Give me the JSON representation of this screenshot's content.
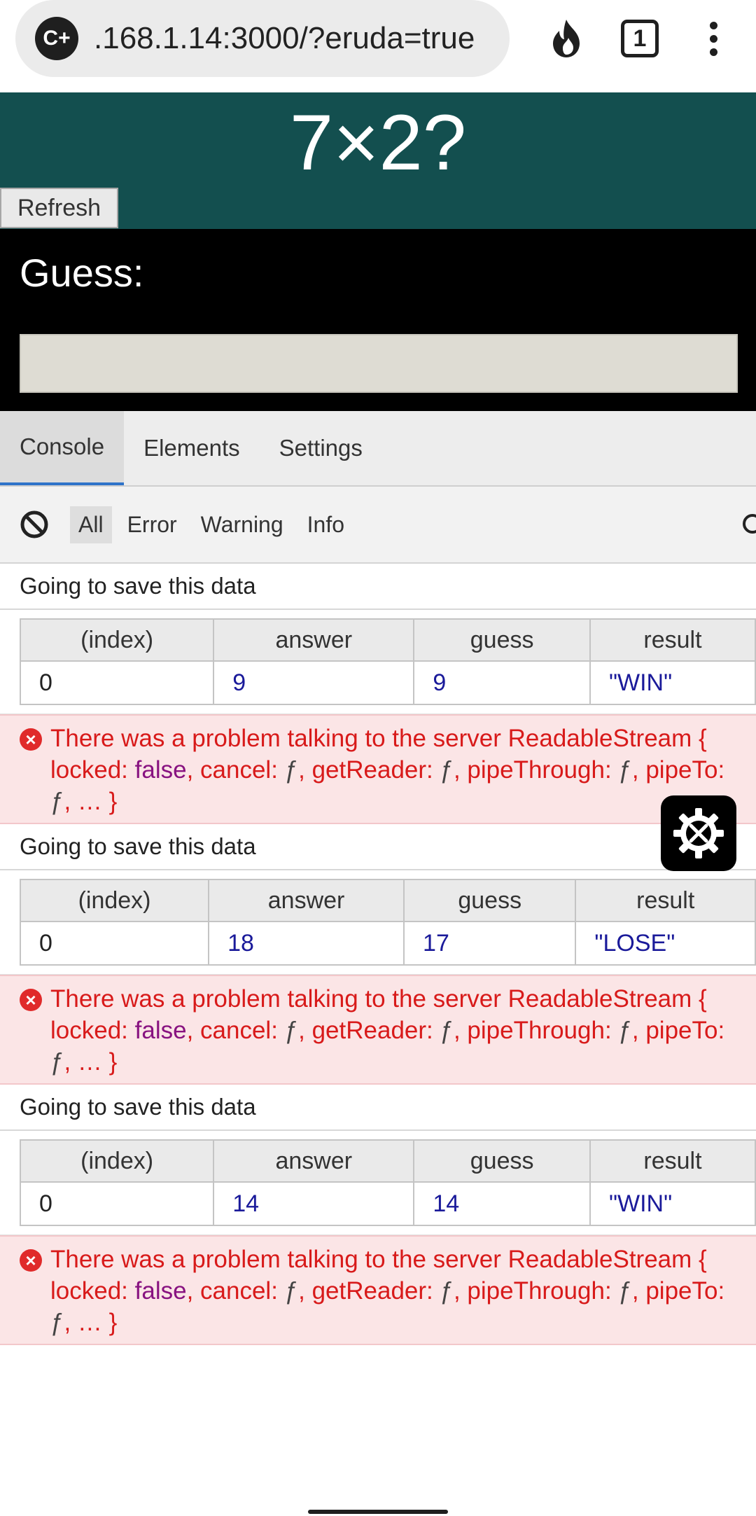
{
  "browser": {
    "site_icon_label": "C+",
    "url": ".168.1.14:3000/?eruda=true",
    "tab_count": "1",
    "icons": {
      "fire": "fire-icon",
      "tabs": "tabs-icon",
      "menu": "more-vert-icon"
    }
  },
  "app": {
    "question": "7×2?",
    "refresh_label": "Refresh",
    "guess_label": "Guess:",
    "guess_value": "",
    "colors": {
      "header_bg": "#134f4f",
      "guess_bg": "#000000"
    }
  },
  "devtools": {
    "tabs": [
      "Console",
      "Elements",
      "Settings"
    ],
    "active_tab": "Console",
    "filters": [
      "All",
      "Error",
      "Warning",
      "Info"
    ],
    "active_filter": "All",
    "logs": [
      {
        "text": "Going to save this data",
        "table": {
          "headers": [
            "(index)",
            "answer",
            "guess",
            "result"
          ],
          "row": [
            "0",
            "9",
            "9",
            "\"WIN\""
          ]
        }
      },
      {
        "error": {
          "line1": "There was a problem talking to the server ReadableStream {",
          "locked": "locked:",
          "false": "false",
          "rest1": ", cancel:",
          "f1": "ƒ",
          "getReader": ", getReader:",
          "f2": "ƒ",
          "pipeThrough": ", pipeThrough:",
          "f3": "ƒ",
          "pipeTo": ", pipeTo:",
          "f4": "ƒ",
          "tail": ", … }"
        }
      },
      {
        "text": "Going to save this data",
        "table": {
          "headers": [
            "(index)",
            "answer",
            "guess",
            "result"
          ],
          "row": [
            "0",
            "18",
            "17",
            "\"LOSE\""
          ]
        }
      },
      {
        "error": {
          "line1": "There was a problem talking to the server ReadableStream {",
          "locked": "locked:",
          "false": "false",
          "rest1": ", cancel:",
          "f1": "ƒ",
          "getReader": ", getReader:",
          "f2": "ƒ",
          "pipeThrough": ", pipeThrough:",
          "f3": "ƒ",
          "pipeTo": ", pipeTo:",
          "f4": "ƒ",
          "tail": ", … }"
        }
      },
      {
        "text": "Going to save this data",
        "table": {
          "headers": [
            "(index)",
            "answer",
            "guess",
            "result"
          ],
          "row": [
            "0",
            "14",
            "14",
            "\"WIN\""
          ]
        }
      },
      {
        "error": {
          "line1": "There was a problem talking to the server ReadableStream {",
          "locked": "locked:",
          "false": "false",
          "rest1": ", cancel:",
          "f1": "ƒ",
          "getReader": ", getReader:",
          "f2": "ƒ",
          "pipeThrough": ", pipeThrough:",
          "f3": "ƒ",
          "pipeTo": ", pipeTo:",
          "f4": "ƒ",
          "tail": ", … }"
        }
      }
    ],
    "eruda_icon": "eruda-tools-icon"
  }
}
